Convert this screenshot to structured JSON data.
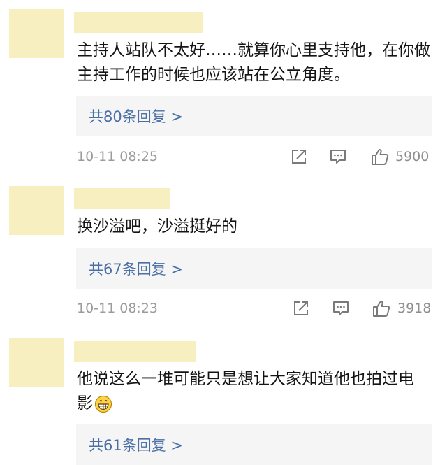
{
  "comments": [
    {
      "text": "主持人站队不太好……就算你心里支持他，在你做主持工作的时候也应该站在公立角度。",
      "reply_label": "共80条回复 >",
      "time": "10-11 08:25",
      "likes": "5900"
    },
    {
      "text": "换沙溢吧，沙溢挺好的",
      "reply_label": "共67条回复 >",
      "time": "10-11 08:23",
      "likes": "3918"
    },
    {
      "text": "他说这么一堆可能只是想让大家知道他也拍过电影",
      "reply_label": "共61条回复 >",
      "emoji": "grin-emoji"
    }
  ],
  "icons": {
    "share": "share-icon",
    "comment": "comment-icon",
    "like": "thumbs-up-icon"
  },
  "colors": {
    "placeholder": "#f7efbf",
    "reply_bg": "#f5f5f5",
    "reply_text": "#4a6fa5",
    "meta_text": "#9b9b9b"
  }
}
